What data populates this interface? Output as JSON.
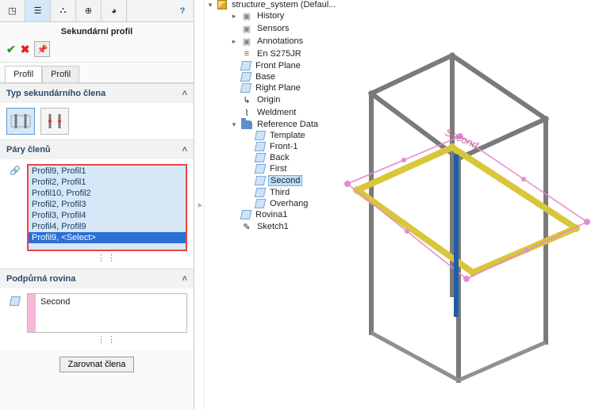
{
  "panel": {
    "title": "Sekundární profil",
    "subtabs": [
      "Profil",
      "Profil"
    ],
    "type_section": {
      "label": "Typ sekundárního člena"
    },
    "pairs_section": {
      "label": "Páry členů",
      "items": [
        "Profil9, Profil1",
        "Profil2, Profil1",
        "Profil10, Profil2",
        "Profil2, Profil3",
        "Profil3, Profil4",
        "Profil4, Profil9",
        "Profil9, <Select>"
      ],
      "selected_index": 6
    },
    "support_section": {
      "label": "Podpůrná rovina",
      "value": "Second"
    },
    "align_button": "Zarovnat člena"
  },
  "tree": {
    "root_truncated": "structure_system  (Defaul...",
    "items": [
      {
        "level": 1,
        "type": "generic",
        "exp": "right",
        "label": "History"
      },
      {
        "level": 1,
        "type": "generic",
        "exp": "none",
        "label": "Sensors"
      },
      {
        "level": 1,
        "type": "generic",
        "exp": "right",
        "label": "Annotations"
      },
      {
        "level": 1,
        "type": "material",
        "exp": "none",
        "label": "En S275JR"
      },
      {
        "level": 1,
        "type": "plane",
        "exp": "none",
        "label": "Front Plane"
      },
      {
        "level": 1,
        "type": "plane",
        "exp": "none",
        "label": "Base"
      },
      {
        "level": 1,
        "type": "plane",
        "exp": "none",
        "label": "Right Plane"
      },
      {
        "level": 1,
        "type": "origin",
        "exp": "none",
        "label": "Origin"
      },
      {
        "level": 1,
        "type": "weld",
        "exp": "none",
        "label": "Weldment"
      },
      {
        "level": 1,
        "type": "folder",
        "exp": "down",
        "label": "Reference Data"
      },
      {
        "level": 2,
        "type": "plane",
        "exp": "none",
        "label": "Template"
      },
      {
        "level": 2,
        "type": "plane",
        "exp": "none",
        "label": "Front-1"
      },
      {
        "level": 2,
        "type": "plane",
        "exp": "none",
        "label": "Back"
      },
      {
        "level": 2,
        "type": "plane",
        "exp": "none",
        "label": "First"
      },
      {
        "level": 2,
        "type": "plane",
        "exp": "none",
        "label": "Second",
        "selected": true
      },
      {
        "level": 2,
        "type": "plane",
        "exp": "none",
        "label": "Third"
      },
      {
        "level": 2,
        "type": "plane",
        "exp": "none",
        "label": "Overhang"
      },
      {
        "level": 1,
        "type": "plane",
        "exp": "none",
        "label": "Rovina1"
      },
      {
        "level": 1,
        "type": "sketch",
        "exp": "none",
        "label": "Sketch1"
      }
    ]
  },
  "viewport": {
    "annotation": "Second"
  }
}
